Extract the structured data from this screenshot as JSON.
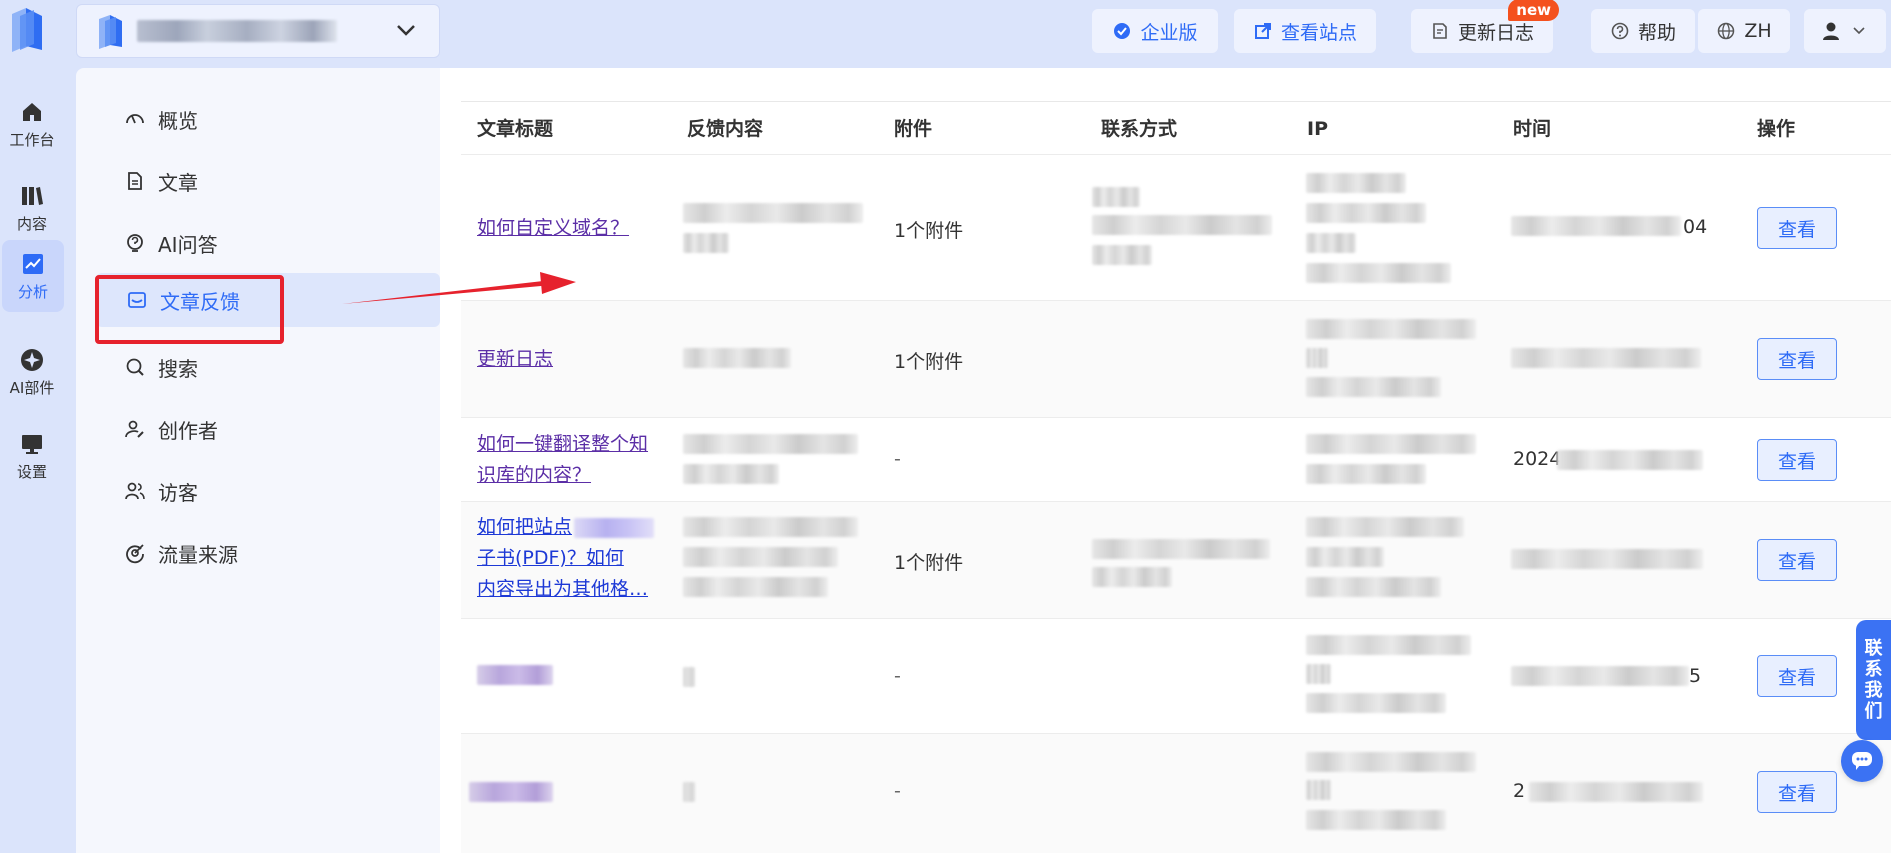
{
  "rail": {
    "items": [
      {
        "label": "工作台"
      },
      {
        "label": "内容"
      },
      {
        "label": "分析"
      },
      {
        "label": "AI部件"
      },
      {
        "label": "设置"
      }
    ]
  },
  "topbar": {
    "enterprise": "企业版",
    "view_site": "查看站点",
    "changelog": "更新日志",
    "new_badge": "new",
    "help": "帮助",
    "language": "ZH"
  },
  "nav": {
    "items": [
      {
        "label": "概览"
      },
      {
        "label": "文章"
      },
      {
        "label": "AI问答"
      },
      {
        "label": "文章反馈"
      },
      {
        "label": "搜索"
      },
      {
        "label": "创作者"
      },
      {
        "label": "访客"
      },
      {
        "label": "流量来源"
      }
    ]
  },
  "table": {
    "headers": [
      "文章标题",
      "反馈内容",
      "附件",
      "联系方式",
      "IP",
      "时间",
      "操作"
    ],
    "rows": [
      {
        "title": "如何自定义域名？",
        "attachment": "1个附件",
        "time_tail": "04",
        "action": "查看"
      },
      {
        "title": "更新日志",
        "attachment": "1个附件",
        "action": "查看"
      },
      {
        "title": "如何一键翻译整个知识库的内容？",
        "attachment": "-",
        "time_head": "2024",
        "action": "查看"
      },
      {
        "title_lines": [
          "如何把站点",
          "子书(PDF)？如何",
          "内容导出为其他格…"
        ],
        "attachment": "1个附件",
        "action": "查看"
      },
      {
        "attachment": "-",
        "time_tail": "5",
        "action": "查看"
      },
      {
        "attachment": "-",
        "time_head": "2",
        "action": "查看"
      }
    ]
  },
  "contact": [
    "联",
    "系",
    "我",
    "们"
  ],
  "colors": {
    "primary": "#2e6bf6",
    "highlight_red": "#e6222d",
    "rail_bg": "#dbe4fb"
  }
}
